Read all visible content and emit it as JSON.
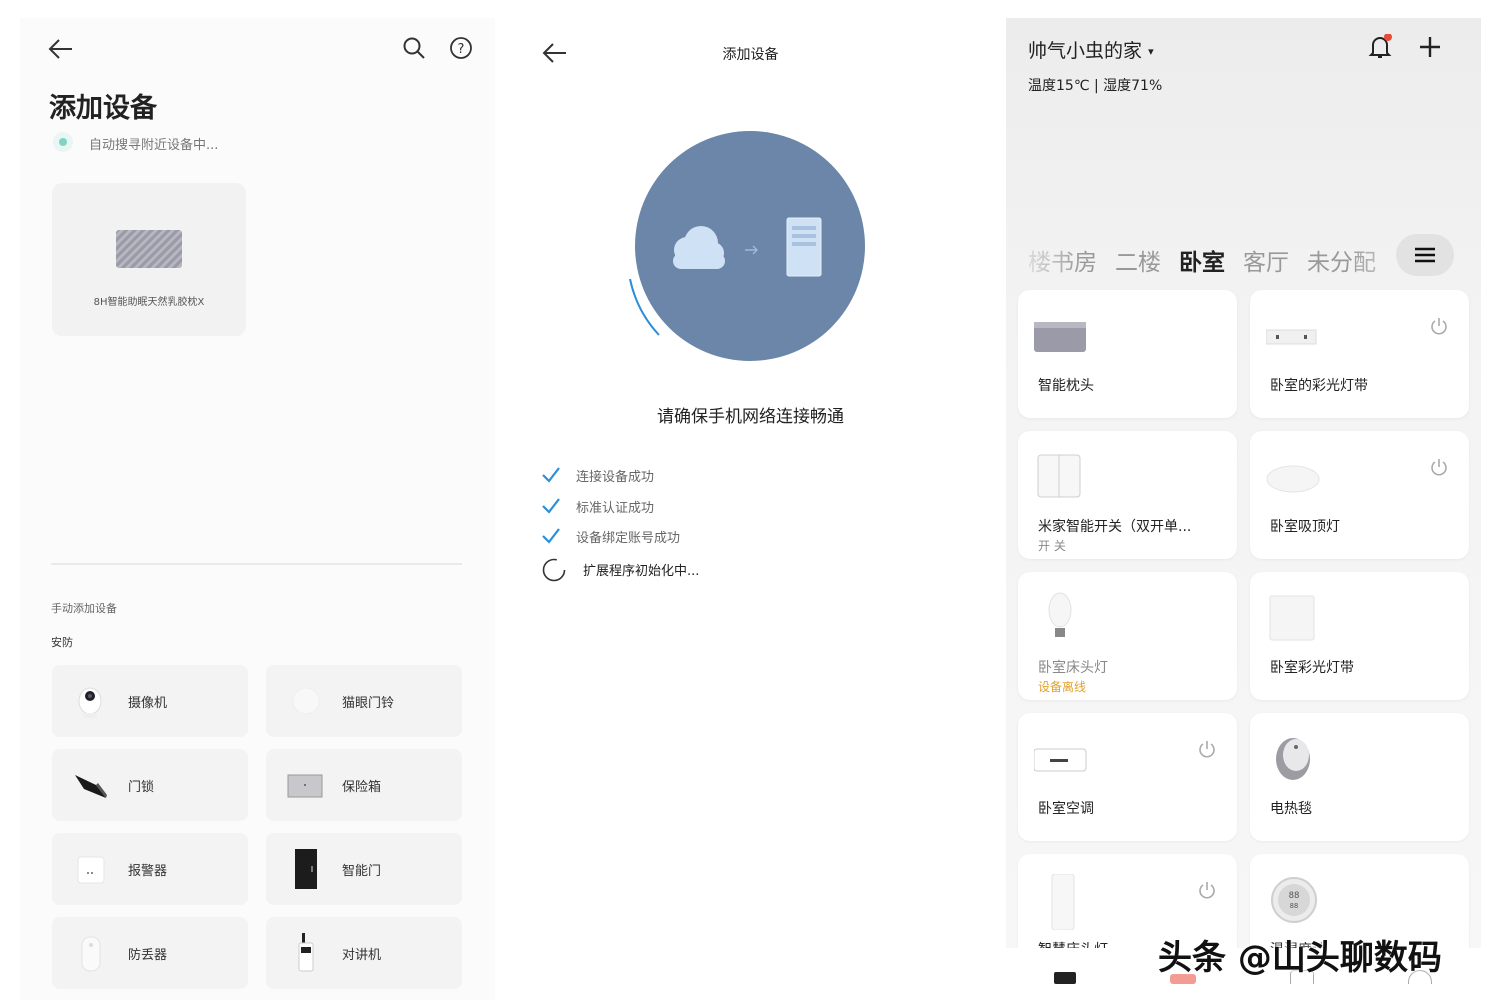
{
  "panel1": {
    "title": "添加设备",
    "status": "自动搜寻附近设备中...",
    "found_device": {
      "label": "8H智能助眠天然乳胶枕X"
    },
    "manual_section": "手动添加设备",
    "category": "安防",
    "manual_devices": [
      {
        "label": "摄像机",
        "icon": "camera-icon"
      },
      {
        "label": "猫眼门铃",
        "icon": "peephole-doorbell-icon"
      },
      {
        "label": "门锁",
        "icon": "door-lock-icon"
      },
      {
        "label": "保险箱",
        "icon": "safe-icon"
      },
      {
        "label": "报警器",
        "icon": "alarm-icon"
      },
      {
        "label": "智能门",
        "icon": "smart-door-icon"
      },
      {
        "label": "防丢器",
        "icon": "anti-lost-tag-icon"
      },
      {
        "label": "对讲机",
        "icon": "walkie-talkie-icon"
      }
    ]
  },
  "panel2": {
    "title": "添加设备",
    "network_message": "请确保手机网络连接畅通",
    "steps": [
      {
        "label": "连接设备成功",
        "state": "done"
      },
      {
        "label": "标准认证成功",
        "state": "done"
      },
      {
        "label": "设备绑定账号成功",
        "state": "done"
      },
      {
        "label": "扩展程序初始化中...",
        "state": "loading"
      }
    ],
    "colors": {
      "circle": "#6b86a8",
      "check": "#2a8fd8",
      "arc": "#2a8fd8"
    }
  },
  "panel3": {
    "home_name": "帅气小虫的家",
    "weather": "温度15℃ | 湿度71%",
    "tabs": [
      "楼书房",
      "二楼",
      "卧室",
      "客厅",
      "未分配"
    ],
    "active_tab": "卧室",
    "devices": [
      {
        "name": "智能枕头",
        "sub": "",
        "power": false,
        "icon": "pillow-icon"
      },
      {
        "name": "卧室的彩光灯带",
        "sub": "",
        "power": true,
        "icon": "light-strip-icon"
      },
      {
        "name": "米家智能开关（双开单...",
        "sub": "开 关",
        "power": false,
        "icon": "wall-switch-icon"
      },
      {
        "name": "卧室吸顶灯",
        "sub": "",
        "power": true,
        "icon": "ceiling-light-icon"
      },
      {
        "name": "卧室床头灯",
        "sub": "设备离线",
        "power": false,
        "icon": "bulb-icon",
        "offline": true
      },
      {
        "name": "卧室彩光灯带",
        "sub": "",
        "power": false,
        "icon": "light-panel-icon"
      },
      {
        "name": "卧室空调",
        "sub": "",
        "power": true,
        "icon": "air-conditioner-icon"
      },
      {
        "name": "电热毯",
        "sub": "",
        "power": false,
        "icon": "heater-icon"
      },
      {
        "name": "智慧床头灯",
        "sub": "",
        "power": true,
        "icon": "lamp-icon"
      },
      {
        "name": "温湿度计",
        "sub": "",
        "power": false,
        "icon": "thermometer-icon"
      }
    ],
    "colors": {
      "notification_dot": "#e84a3a",
      "offline": "#e2a22c"
    }
  },
  "watermark": "头条 @山头聊数码"
}
